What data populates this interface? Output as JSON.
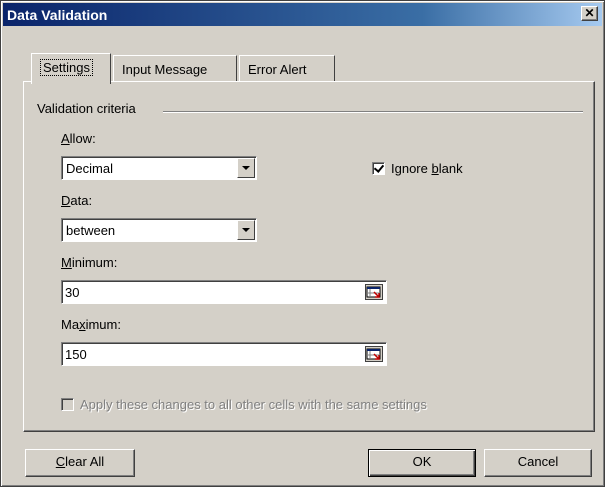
{
  "window": {
    "title": "Data Validation"
  },
  "tabs": [
    {
      "label": "Settings",
      "active": true
    },
    {
      "label": "Input Message",
      "active": false
    },
    {
      "label": "Error Alert",
      "active": false
    }
  ],
  "settings": {
    "group_label": "Validation criteria",
    "allow": {
      "label_pre": "",
      "label_key": "A",
      "label_post": "llow:",
      "value": "Decimal"
    },
    "data": {
      "label_pre": "",
      "label_key": "D",
      "label_post": "ata:",
      "value": "between"
    },
    "minimum": {
      "label_pre": "",
      "label_key": "M",
      "label_post": "inimum:",
      "value": "30"
    },
    "maximum": {
      "label_pre": "Ma",
      "label_key": "x",
      "label_post": "imum:",
      "value": "150"
    },
    "ignore_blank": {
      "pre": "Ignore ",
      "key": "b",
      "post": "lank",
      "checked": true
    },
    "apply_all": {
      "label": "Apply these changes to all other cells with the same settings",
      "checked": false,
      "enabled": false
    }
  },
  "buttons": {
    "clear_all_key": "C",
    "clear_all_rest": "lear All",
    "ok": "OK",
    "cancel": "Cancel"
  },
  "colors": {
    "title_start": "#0a246a",
    "title_end": "#a6caf0",
    "face": "#d4d0c8"
  }
}
